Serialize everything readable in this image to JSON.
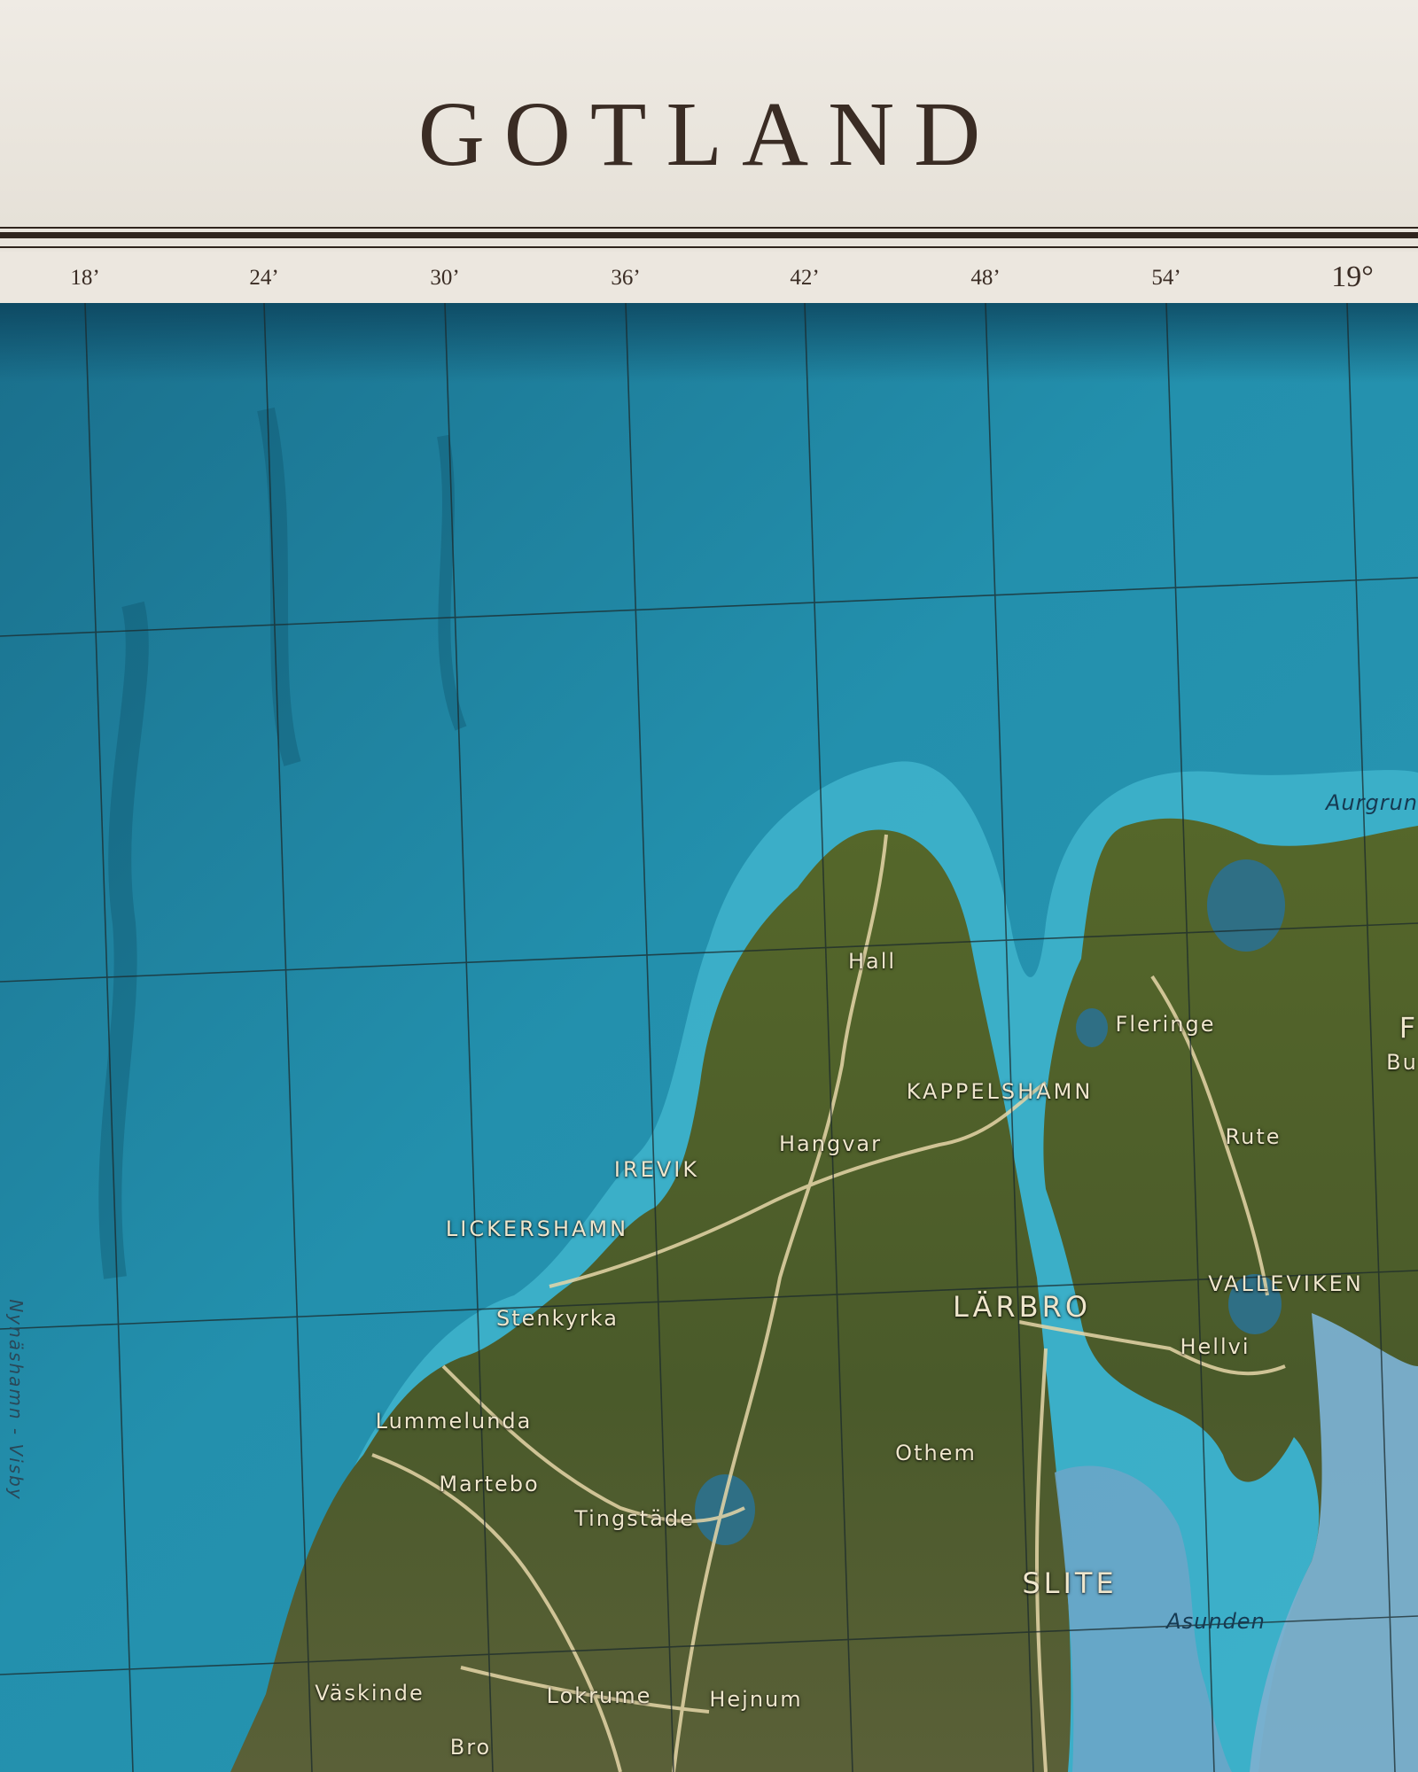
{
  "title": "GOTLAND",
  "scale": {
    "ticks": [
      "18’",
      "24’",
      "30’",
      "36’",
      "42’",
      "48’",
      "54’",
      "19°"
    ]
  },
  "map": {
    "colors": {
      "deep_sea": "#1f7f9c",
      "shallow_sea": "#3fb4cc",
      "land": "#4f5f2a",
      "road": "#e6d6a8",
      "lagoon": "#6aa6c8",
      "label": "#efe6cc",
      "water_label": "#163a52"
    },
    "places": {
      "hall": "Hall",
      "kappelshamn": "KAPPELSHAMN",
      "fleringe": "Fleringe",
      "rute": "Rute",
      "hangvar": "Hangvar",
      "irevik": "IREVIK",
      "lickershamn": "LICKERSHAMN",
      "larbro": "LÄRBRO",
      "valleviken": "VALLEVIKEN",
      "hellvi": "Hellvi",
      "stenkyrka": "Stenkyrka",
      "lummelunda": "Lummelunda",
      "othem": "Othem",
      "martebo": "Martebo",
      "tingstade": "Tingstäde",
      "slite": "SLITE",
      "vaskinde": "Väskinde",
      "lokrume": "Lokrume",
      "hejnum": "Hejnum",
      "bro": "Bro",
      "fardume_partial": "F",
      "bunge_partial": "Bu"
    },
    "waters": {
      "aurgrund_partial": "Aurgrun",
      "asunden": "Asunden"
    },
    "ferry_route": "Nynäshamn - Visby"
  }
}
